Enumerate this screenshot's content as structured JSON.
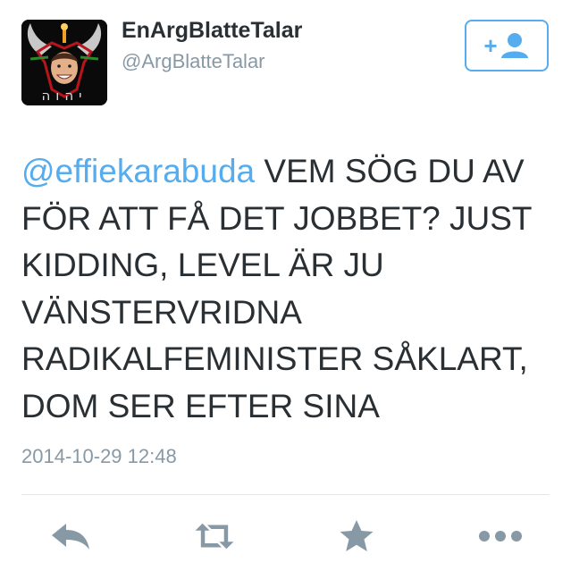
{
  "user": {
    "display_name": "EnArgBlatteTalar",
    "handle": "@ArgBlatteTalar",
    "avatar_caption": "יהוה"
  },
  "follow_button": {
    "icon": "add-person-icon",
    "symbol": "+"
  },
  "tweet": {
    "mention": "@effiekarabuda",
    "text": " VEM SÖG DU AV FÖR ATT FÅ DET JOBBET? JUST KIDDING, LEVEL ÄR JU VÄNSTERVRIDNA RADIKALFEMINISTER SÅKLART, DOM SER EFTER SINA",
    "timestamp": "2014-10-29 12:48"
  },
  "actions": [
    {
      "icon": "reply-icon"
    },
    {
      "icon": "retweet-icon"
    },
    {
      "icon": "favorite-star-icon"
    },
    {
      "icon": "more-icon"
    }
  ],
  "colors": {
    "accent": "#55acee",
    "text": "#292f33",
    "muted": "#8899a6",
    "icon": "#8899a6",
    "divider": "#e1e8ed"
  }
}
